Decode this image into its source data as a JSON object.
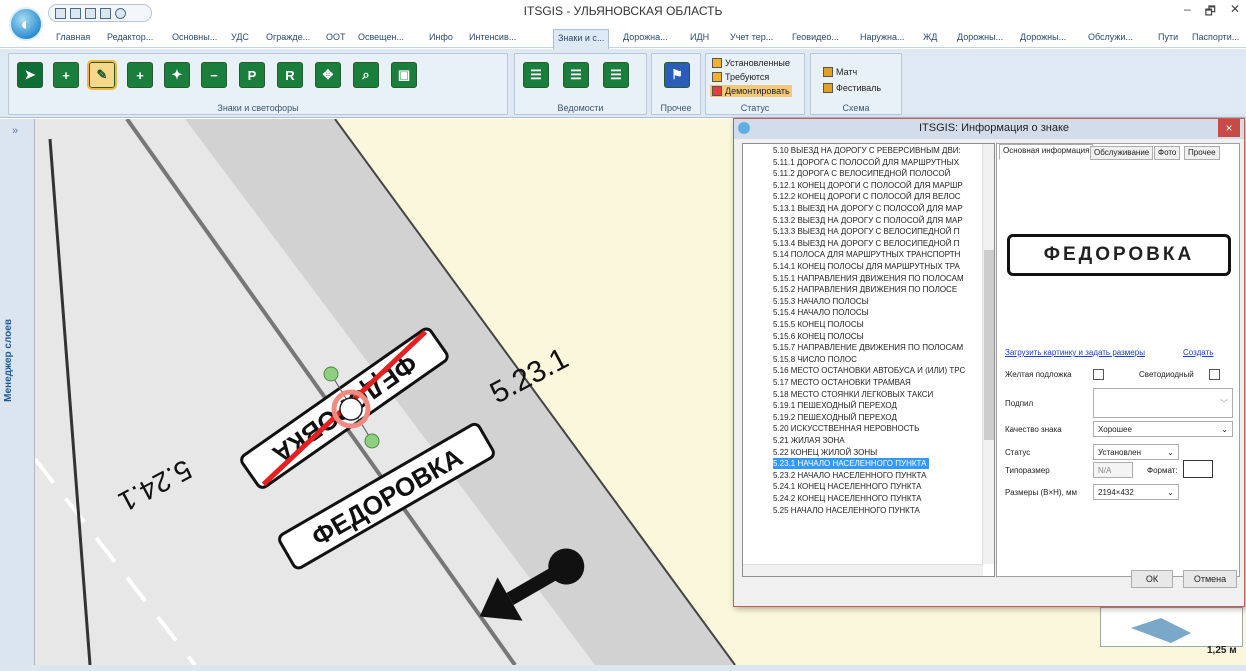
{
  "app": {
    "title": "ITSGIS - УЛЬЯНОВСКАЯ ОБЛАСТЬ",
    "win_controls": [
      "–",
      "🗗",
      "✕"
    ]
  },
  "tabs": [
    {
      "label": "Главная"
    },
    {
      "label": "Редактор..."
    },
    {
      "label": "Основны..."
    },
    {
      "label": "УДС"
    },
    {
      "label": "Огражде..."
    },
    {
      "label": "ООТ"
    },
    {
      "label": "Освещен..."
    },
    {
      "label": "Инфо"
    },
    {
      "label": "Интенсив..."
    },
    {
      "label": "Знаки и с..."
    },
    {
      "label": "Дорожна..."
    },
    {
      "label": "ИДН"
    },
    {
      "label": "Учет тер..."
    },
    {
      "label": "Геовидео..."
    },
    {
      "label": "Наружна..."
    },
    {
      "label": "ЖД"
    },
    {
      "label": "Дорожны..."
    },
    {
      "label": "Дорожны..."
    },
    {
      "label": "Обслужи..."
    },
    {
      "label": "Пути"
    },
    {
      "label": "Паспорти..."
    }
  ],
  "ribbon": {
    "groups": [
      {
        "label": "Знаки и светофоры"
      },
      {
        "label": "Ведомости"
      },
      {
        "label": "Прочее"
      },
      {
        "label": "Статус"
      },
      {
        "label": "Схема"
      }
    ],
    "status_items": [
      {
        "label": "Установленные",
        "color": "#f0b030"
      },
      {
        "label": "Требуются",
        "color": "#f0b030"
      },
      {
        "label": "Демонтировать",
        "color": "#e04040"
      }
    ],
    "schema_items": [
      {
        "label": "Матч"
      },
      {
        "label": "Фестиваль"
      }
    ]
  },
  "left_panel": {
    "label": "Менеджер слоев",
    "collapse": "»"
  },
  "map": {
    "sign_text": "ФЕДОРОВКА",
    "code_start": "5.23.1",
    "code_end": "5.24.1",
    "scale": "1,25 м"
  },
  "dialog": {
    "title": "ITSGIS: Информация о знаке",
    "close": "×",
    "tree_items": [
      "5.10 ВЫЕЗД НА ДОРОГУ С РЕВЕРСИВНЫМ ДВИ:",
      "5.11.1 ДОРОГА С ПОЛОСОЙ ДЛЯ МАРШРУТНЫХ",
      "5.11.2 ДОРОГА С ВЕЛОСИПЕДНОЙ ПОЛОСОЙ",
      "5.12.1 КОНЕЦ ДОРОГИ С ПОЛОСОЙ ДЛЯ МАРШР",
      "5.12.2 КОНЕЦ ДОРОГИ С ПОЛОСОЙ ДЛЯ ВЕЛОС",
      "5.13.1 ВЫЕЗД НА ДОРОГУ С ПОЛОСОЙ ДЛЯ МАР",
      "5.13.2 ВЫЕЗД НА ДОРОГУ С ПОЛОСОЙ ДЛЯ МАР",
      "5.13.3 ВЫЕЗД НА ДОРОГУ С ВЕЛОСИПЕДНОЙ П",
      "5.13.4 ВЫЕЗД НА ДОРОГУ С ВЕЛОСИПЕДНОЙ П",
      "5.14 ПОЛОСА ДЛЯ МАРШРУТНЫХ ТРАНСПОРТН",
      "5.14.1 КОНЕЦ ПОЛОСЫ ДЛЯ МАРШРУТНЫХ ТРА",
      "5.15.1 НАПРАВЛЕНИЯ ДВИЖЕНИЯ ПО ПОЛОСАМ",
      "5.15.2 НАПРАВЛЕНИЯ ДВИЖЕНИЯ ПО ПОЛОСЕ",
      "5.15.3 НАЧАЛО ПОЛОСЫ",
      "5.15.4 НАЧАЛО ПОЛОСЫ",
      "5.15.5 КОНЕЦ ПОЛОСЫ",
      "5.15.6 КОНЕЦ ПОЛОСЫ",
      "5.15.7 НАПРАВЛЕНИЕ ДВИЖЕНИЯ ПО ПОЛОСАМ",
      "5.15.8 ЧИСЛО ПОЛОС",
      "5.16 МЕСТО ОСТАНОВКИ АВТОБУСА И (ИЛИ) ТРС",
      "5.17 МЕСТО ОСТАНОВКИ ТРАМВАЯ",
      "5.18 МЕСТО СТОЯНКИ ЛЕГКОВЫХ ТАКСИ",
      "5.19.1 ПЕШЕХОДНЫЙ ПЕРЕХОД",
      "5.19.2 ПЕШЕХОДНЫЙ ПЕРЕХОД",
      "5.20 ИСКУССТВЕННАЯ НЕРОВНОСТЬ",
      "5.21 ЖИЛАЯ ЗОНА",
      "5.22 КОНЕЦ ЖИЛОЙ ЗОНЫ",
      "5.23.1 НАЧАЛО НАСЕЛЕННОГО ПУНКТА",
      "5.23.2 НАЧАЛО НАСЕЛЕННОГО ПУНКТА",
      "5.24.1 КОНЕЦ НАСЕЛЕННОГО ПУНКТА",
      "5.24.2 КОНЕЦ НАСЕЛЕННОГО ПУНКТА",
      "5.25 НАЧАЛО НАСЕЛЕННОГО ПУНКТА"
    ],
    "selected_index": 27,
    "tabs": [
      {
        "label": "Основная информация"
      },
      {
        "label": "Обслуживание"
      },
      {
        "label": "Фото"
      },
      {
        "label": "Прочее"
      }
    ],
    "sign_preview": "ФЕДОРОВКА",
    "link_upload": "Загрузить картинку и задать размеры",
    "link_create": "Создать",
    "yellow_bg_label": "Желтая подложка",
    "led_label": "Светодиодный",
    "caption_label": "Подпил",
    "quality_label": "Качество знака",
    "quality_value": "Хорошее",
    "status_label": "Статус",
    "status_value": "Установлен",
    "size_type_label": "Типоразмер",
    "size_type_value": "N/A",
    "format_label": "Формат:",
    "dims_label": "Размеры (В×Н), мм",
    "dims_value": "2194×432",
    "ok": "ОК",
    "cancel": "Отмена"
  }
}
